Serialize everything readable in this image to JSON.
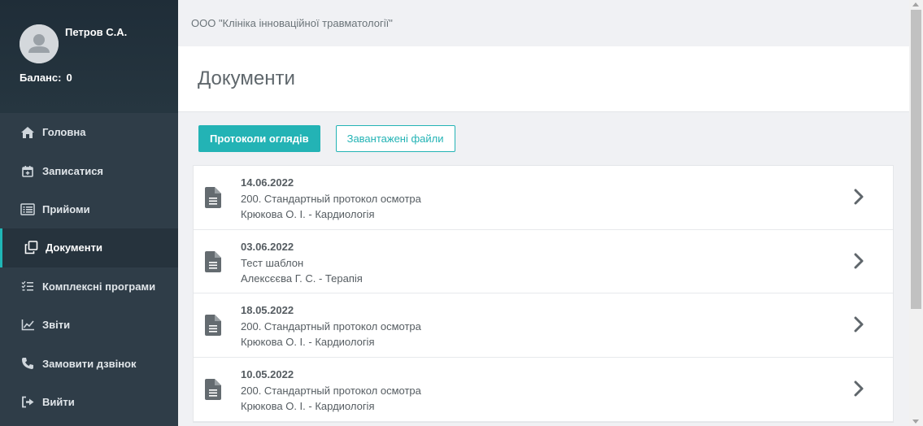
{
  "user": {
    "name": "Петров С.А.",
    "balance_label": "Баланс:",
    "balance_value": "0"
  },
  "nav": [
    {
      "label": "Головна",
      "icon": "home-icon"
    },
    {
      "label": "Записатися",
      "icon": "calendar-plus-icon"
    },
    {
      "label": "Прийоми",
      "icon": "list-icon"
    },
    {
      "label": "Документи",
      "icon": "copy-icon",
      "active": true
    },
    {
      "label": "Комплексні програми",
      "icon": "checklist-icon"
    },
    {
      "label": "Звіти",
      "icon": "chart-line-icon"
    },
    {
      "label": "Замовити дзвінок",
      "icon": "phone-icon"
    },
    {
      "label": "Вийти",
      "icon": "logout-icon"
    }
  ],
  "header": {
    "org": "ООО \"Клініка інноваційної травматології\""
  },
  "page": {
    "title": "Документи"
  },
  "tabs": {
    "protocols": "Протоколи оглядів",
    "files": "Завантажені файли"
  },
  "documents": [
    {
      "date": "14.06.2022",
      "name": "200. Стандартный протокол осмотра",
      "doctor": "Крюкова О. І. - Кардиологія"
    },
    {
      "date": "03.06.2022",
      "name": "Тест шаблон",
      "doctor": "Алексєєва Г. С. - Терапія"
    },
    {
      "date": "18.05.2022",
      "name": "200. Стандартный протокол осмотра",
      "doctor": "Крюкова О. І. - Кардиологія"
    },
    {
      "date": "10.05.2022",
      "name": "200. Стандартный протокол осмотра",
      "doctor": "Крюкова О. І. - Кардиологія"
    }
  ],
  "colors": {
    "accent": "#23b3b5",
    "sidebar": "#2f3d48",
    "sidebar_top": "#1f2d38"
  }
}
